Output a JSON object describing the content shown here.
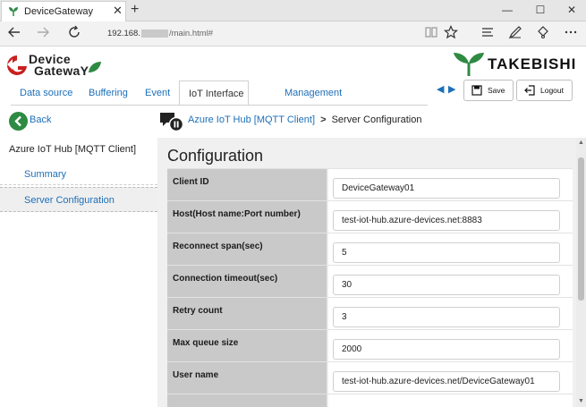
{
  "browser": {
    "tab_title": "DeviceGateway",
    "new_tab_glyph": "+",
    "close_tab_glyph": "✕",
    "window_controls": [
      "—",
      "☐",
      "✕"
    ],
    "address_prefix": "192.168.",
    "address_suffix": "/main.html#",
    "icons": [
      "back-icon",
      "forward-icon",
      "refresh-icon",
      "reading-view-icon",
      "favorite-star-icon",
      "hub-icon",
      "notes-icon",
      "share-icon",
      "more-icon"
    ]
  },
  "header": {
    "logo_line1": "Device",
    "logo_line2": "GatewaY",
    "brand": "TAKEBISHI",
    "save_label": "Save",
    "logout_label": "Logout",
    "brand_color": "#2f8a43",
    "logo_red": "#c8201e"
  },
  "menu": {
    "items": [
      {
        "label": "Data source"
      },
      {
        "label": "Buffering"
      },
      {
        "label": "Event"
      },
      {
        "label": "IoT Interface"
      },
      {
        "label": "Management"
      }
    ],
    "active": "IoT Interface"
  },
  "sidebar": {
    "back_label": "Back",
    "title": "Azure IoT Hub  [MQTT Client]",
    "items": [
      {
        "label": "Summary"
      },
      {
        "label": "Server Configuration"
      }
    ],
    "selected": "Server Configuration"
  },
  "breadcrumb": {
    "link": "Azure IoT Hub  [MQTT Client]",
    "separator": ">",
    "current": "Server Configuration"
  },
  "config": {
    "title": "Configuration",
    "rows": [
      {
        "label": "Client ID",
        "value": "DeviceGateway01"
      },
      {
        "label": "Host(Host name:Port number)",
        "value": "test-iot-hub.azure-devices.net:8883"
      },
      {
        "label": "Reconnect span(sec)",
        "value": "5"
      },
      {
        "label": "Connection timeout(sec)",
        "value": "30"
      },
      {
        "label": "Retry count",
        "value": "3"
      },
      {
        "label": "Max queue size",
        "value": "2000"
      },
      {
        "label": "User name",
        "value": "test-iot-hub.azure-devices.net/DeviceGateway01"
      }
    ]
  },
  "colors": {
    "link": "#1d6fb8",
    "label_bg": "#c9c9c9",
    "content_bg": "#f0f0f0"
  }
}
